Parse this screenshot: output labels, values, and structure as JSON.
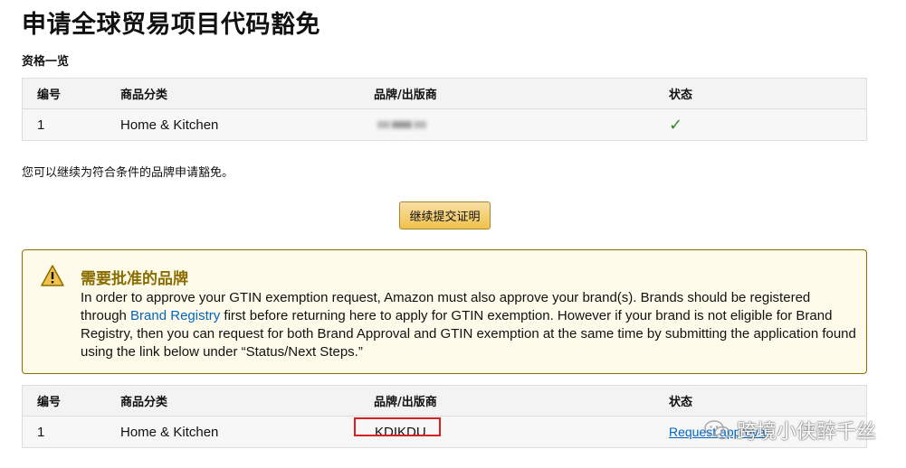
{
  "page": {
    "title": "申请全球贸易项目代码豁免",
    "section_label": "资格一览"
  },
  "table1": {
    "headers": [
      "编号",
      "商品分类",
      "品牌/出版商",
      "状态"
    ],
    "rows": [
      {
        "num": "1",
        "category": "Home & Kitchen",
        "brand": "",
        "status": "✓"
      }
    ]
  },
  "note": "您可以继续为符合条件的品牌申请豁免。",
  "continue_button": "继续提交证明",
  "alert": {
    "title": "需要批准的品牌",
    "text_before_link": "In order to approve your GTIN exemption request, Amazon must also approve your brand(s). Brands should be registered through ",
    "link": "Brand Registry",
    "text_after_link": " first before returning here to apply for GTIN exemption. However if your brand is not eligible for Brand Registry, then you can request for both Brand Approval and GTIN exemption at the same time by submitting the application found using the link below under “Status/Next Steps.”"
  },
  "table2": {
    "headers": [
      "编号",
      "商品分类",
      "品牌/出版商",
      "状态"
    ],
    "rows": [
      {
        "num": "1",
        "category": "Home & Kitchen",
        "brand": "KDIKDU",
        "status": "Request approval"
      }
    ]
  },
  "watermark": "跨境小侠醉千丝",
  "colors": {
    "accent_link": "#0066c0",
    "button": "#f0c14b",
    "alert_border": "#8c6e00",
    "check": "#2e8b2e",
    "highlight_box": "#d92020"
  }
}
